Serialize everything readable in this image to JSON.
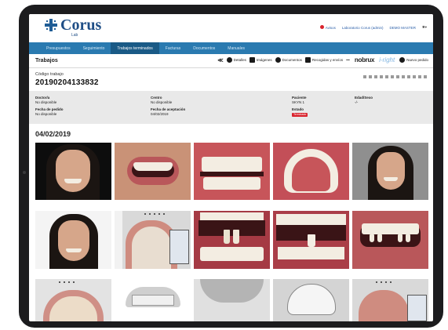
{
  "app": {
    "logo_text": "Corus",
    "logo_sub": "Lab"
  },
  "user_menu": {
    "notifications": "Avisos",
    "lab": "Laboratorio Corus (admin)",
    "user": "DEMO MASTER"
  },
  "nav": {
    "tabs": [
      {
        "label": "Presupuestos",
        "active": false
      },
      {
        "label": "Seguimiento",
        "active": false
      },
      {
        "label": "Trabajos terminados",
        "active": true
      },
      {
        "label": "Facturas",
        "active": false
      },
      {
        "label": "Documentos",
        "active": false
      },
      {
        "label": "Manuales",
        "active": false
      }
    ]
  },
  "toolbar": {
    "title": "Trabajos",
    "actions": {
      "detalles": "Detalles",
      "imagenes": "Imágenes",
      "documentos": "Documentos",
      "recogidas": "Recogidas y envíos",
      "more": "•••",
      "nobrux": "nobrux",
      "iright": "i-right",
      "nuevo": "Nuevo pedido"
    }
  },
  "work": {
    "code_label": "Código trabajo",
    "code": "20190204133832"
  },
  "details": {
    "doctor_label": "Doctor/a",
    "doctor_value": "No disponible",
    "centro_label": "Centro",
    "centro_value": "No disponible",
    "paciente_label": "Paciente",
    "paciente_value": "SKYN 1",
    "edad_label": "Edad/Sexo",
    "edad_value": "-/-",
    "pedido_label": "Fecha de pedido",
    "pedido_value": "No disponible",
    "aceptacion_label": "Fecha de aceptación",
    "aceptacion_value": "04/02/2019",
    "estado_label": "Estado",
    "estado_value": "Terminado"
  },
  "gallery": {
    "date": "04/02/2019"
  },
  "colors": {
    "nav": "#2a7ab0",
    "nav_active": "#1a5a86",
    "brand": "#1f4e86",
    "status": "#d9232d"
  }
}
